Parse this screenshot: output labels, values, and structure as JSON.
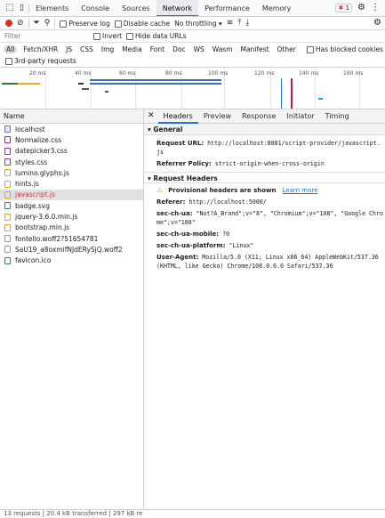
{
  "panel_tabs": [
    "Elements",
    "Console",
    "Sources",
    "Network",
    "Performance",
    "Memory"
  ],
  "errors_badge": "1",
  "toolbar": {
    "preserve_log": "Preserve log",
    "disable_cache": "Disable cache",
    "throttling": "No throttling"
  },
  "filter": {
    "placeholder": "Filter",
    "invert": "Invert",
    "hide_data_urls": "Hide data URLs"
  },
  "types": [
    "All",
    "Fetch/XHR",
    "JS",
    "CSS",
    "Img",
    "Media",
    "Font",
    "Doc",
    "WS",
    "Wasm",
    "Manifest",
    "Other"
  ],
  "blocked_cookies": "Has blocked cookies",
  "blocked_requests": "Blocked Requests",
  "third_party": "3rd-party requests",
  "timeline_ticks": [
    "20 ms",
    "40 ms",
    "60 ms",
    "80 ms",
    "100 ms",
    "120 ms",
    "140 ms",
    "160 ms"
  ],
  "list_header": "Name",
  "files": [
    {
      "name": "localhost",
      "type": "doc"
    },
    {
      "name": "Normalize.css",
      "type": "css"
    },
    {
      "name": "datepicker3.css",
      "type": "css"
    },
    {
      "name": "styles.css",
      "type": "css"
    },
    {
      "name": "lumino.glyphs.js",
      "type": "js"
    },
    {
      "name": "hints.js",
      "type": "js"
    },
    {
      "name": "javascript.js",
      "type": "js"
    },
    {
      "name": "badge.svg",
      "type": "img"
    },
    {
      "name": "jquery-3.6.0.min.js",
      "type": "js"
    },
    {
      "name": "bootstrap.min.js",
      "type": "js"
    },
    {
      "name": "fontello.woff2?51654781",
      "type": "font"
    },
    {
      "name": "SaU19_a8oxmifNJdERySjQ.woff2",
      "type": "font"
    },
    {
      "name": "favicon.ico",
      "type": "img"
    }
  ],
  "status": "13 requests | 20.4 kB transferred | 297 kB re",
  "detail_tabs": [
    "Headers",
    "Preview",
    "Response",
    "Initiator",
    "Timing"
  ],
  "general": {
    "title": "General",
    "request_url_k": "Request URL:",
    "request_url_v": "http://localhost:8081/script-provider/javascript.js",
    "referrer_k": "Referrer Policy:",
    "referrer_v": "strict-origin-when-cross-origin"
  },
  "request_headers": {
    "title": "Request Headers",
    "provisional": "Provisional headers are shown",
    "learn_more": "Learn more",
    "rows": [
      {
        "k": "Referer:",
        "v": "http://localhost:5000/"
      },
      {
        "k": "sec-ch-ua:",
        "v": "\"Not?A_Brand\";v=\"8\", \"Chromium\";v=\"108\", \"Google Chrome\";v=\"108\""
      },
      {
        "k": "sec-ch-ua-mobile:",
        "v": "?0"
      },
      {
        "k": "sec-ch-ua-platform:",
        "v": "\"Linux\""
      },
      {
        "k": "User-Agent:",
        "v": "Mozilla/5.0 (X11; Linux x86_64) AppleWebKit/537.36 (KHTML, like Gecko) Chrome/108.0.0.0 Safari/537.36"
      }
    ]
  },
  "colors": {
    "accent": "#1a73e8",
    "error": "#d93025",
    "waterfall": "#3b6fc4"
  }
}
